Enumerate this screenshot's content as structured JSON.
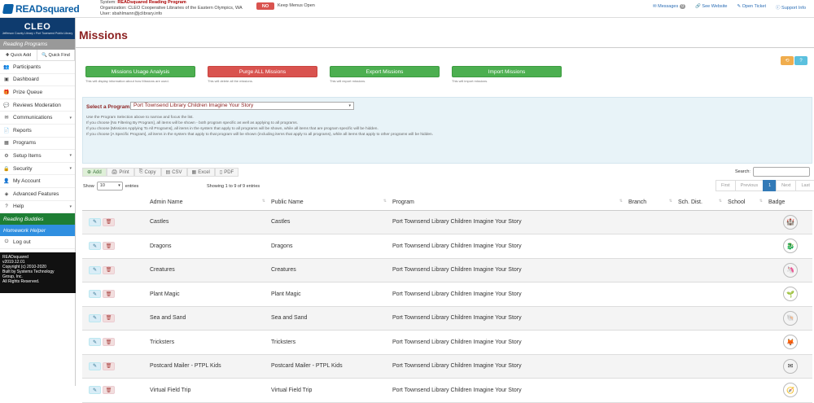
{
  "app": {
    "logo": "READsquared"
  },
  "system": {
    "line1_label": "System:",
    "line1_value": "READsquared Reading Program",
    "line2": "Organization: CLEO Cooperative Libraries of the Eastern Olympics, WA",
    "line3": "User: sbahlmann@jclibrary.info",
    "menus_toggle": "NO",
    "menus_label": "Keep Menus Open"
  },
  "toplinks": {
    "messages": "Messages",
    "messages_count": "0",
    "website": "See Website",
    "ticket": "Open Ticket",
    "support": "Support Info"
  },
  "sidebar": {
    "cleo_title": "CLEO",
    "cleo_sub": "Jefferson County Library • Port Townsend Public Library",
    "section_reading": "Reading Programs",
    "quick_add": "Quick Add",
    "quick_find": "Quick Find",
    "items": [
      {
        "label": "Participants",
        "icon": "👥"
      },
      {
        "label": "Dashboard",
        "icon": "▣"
      },
      {
        "label": "Prize Queue",
        "icon": "🎁"
      },
      {
        "label": "Reviews Moderation",
        "icon": "💬"
      },
      {
        "label": "Communications",
        "icon": "✉"
      },
      {
        "label": "Reports",
        "icon": "📄"
      },
      {
        "label": "Programs",
        "icon": "▦"
      },
      {
        "label": "Setup Items",
        "icon": "⚙"
      },
      {
        "label": "Security",
        "icon": "🔒"
      },
      {
        "label": "My Account",
        "icon": "👤"
      },
      {
        "label": "Advanced Features",
        "icon": "◈"
      },
      {
        "label": "Help",
        "icon": "?"
      }
    ],
    "section_buddies": "Reading Buddies",
    "section_homework": "Homework Helper",
    "logout": "Log out",
    "footer": [
      "READsquared",
      "v2019.12.01",
      "Copyright (c) 2010-2020",
      "Built by Systems Technology",
      "Group, Inc.",
      "All Rights Reserved."
    ]
  },
  "page": {
    "title": "Missions"
  },
  "actions": [
    {
      "label": "Missions Usage Analysis",
      "note": "This will display information about how Missions are used.",
      "color": "green"
    },
    {
      "label": "Purge ALL Missions",
      "note": "This will delete all the missions.",
      "color": "red"
    },
    {
      "label": "Export Missions",
      "note": "This will export missions.",
      "color": "green"
    },
    {
      "label": "Import Missions",
      "note": "This will import missions.",
      "color": "green"
    }
  ],
  "filter": {
    "label": "Select a Program:",
    "value": "Port Townsend Library Children Imagine Your Story",
    "notes": [
      "Use the Program Selection above to narrow and focus the list.",
      "If you choose [No Filtering By Program], all items will be shown - both program specific as well as applying to all programs.",
      "If you choose [Missions Applying To All Programs], all items in the system that apply to all programs will be shown, while all items that are program specific will be hidden.",
      "If you choose [A Specific Program], all items in the system that apply to that program will be shown (including items that apply to all programs), while all items that apply to other programs will be hidden."
    ]
  },
  "toolbar": {
    "add": "Add",
    "print": "Print",
    "copy": "Copy",
    "csv": "CSV",
    "excel": "Excel",
    "pdf": "PDF"
  },
  "table_ctrl": {
    "search_label": "Search:",
    "show_label": "Show",
    "show_value": "10",
    "entries_label": "entries",
    "info": "Showing 1 to 9 of 9 entries",
    "pager": [
      "First",
      "Previous",
      "1",
      "Next",
      "Last"
    ]
  },
  "columns": [
    "Admin Name",
    "Public Name",
    "Program",
    "Branch",
    "Sch. Dist.",
    "School",
    "Badge"
  ],
  "rows": [
    {
      "admin": "Castles",
      "public": "Castles",
      "program": "Port Townsend Library Children Imagine Your Story",
      "badge": "🏰"
    },
    {
      "admin": "Dragons",
      "public": "Dragons",
      "program": "Port Townsend Library Children Imagine Your Story",
      "badge": "🐉"
    },
    {
      "admin": "Creatures",
      "public": "Creatures",
      "program": "Port Townsend Library Children Imagine Your Story",
      "badge": "🦄"
    },
    {
      "admin": "Plant Magic",
      "public": "Plant Magic",
      "program": "Port Townsend Library Children Imagine Your Story",
      "badge": "🌱"
    },
    {
      "admin": "Sea and Sand",
      "public": "Sea and Sand",
      "program": "Port Townsend Library Children Imagine Your Story",
      "badge": "🐚"
    },
    {
      "admin": "Tricksters",
      "public": "Tricksters",
      "program": "Port Townsend Library Children Imagine Your Story",
      "badge": "🦊"
    },
    {
      "admin": "Postcard Mailer - PTPL Kids",
      "public": "Postcard Mailer - PTPL Kids",
      "program": "Port Townsend Library Children Imagine Your Story",
      "badge": "✉"
    },
    {
      "admin": "Virtual Field Trip",
      "public": "Virtual Field Trip",
      "program": "Port Townsend Library Children Imagine Your Story",
      "badge": "🧭"
    }
  ]
}
